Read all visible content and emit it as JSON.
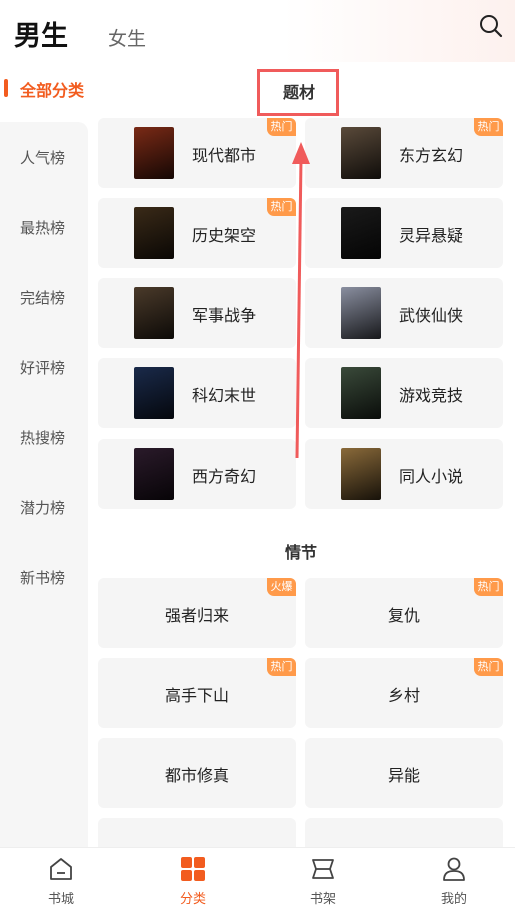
{
  "header": {
    "tab_male": "男生",
    "tab_female": "女生"
  },
  "sidebar": {
    "items": [
      "全部分类",
      "人气榜",
      "最热榜",
      "完结榜",
      "好评榜",
      "热搜榜",
      "潜力榜",
      "新书榜"
    ]
  },
  "sections": {
    "topic_title": "题材",
    "plot_title": "情节"
  },
  "topics": [
    {
      "label": "现代都市",
      "badge": "热门",
      "cover": "#7a2a16"
    },
    {
      "label": "东方玄幻",
      "badge": "热门",
      "cover": "#5a4a3a"
    },
    {
      "label": "历史架空",
      "badge": "热门",
      "cover": "#3a2a18"
    },
    {
      "label": "灵异悬疑",
      "badge": "",
      "cover": "#1a1a1a"
    },
    {
      "label": "军事战争",
      "badge": "",
      "cover": "#4a3a2a"
    },
    {
      "label": "武侠仙侠",
      "badge": "",
      "cover": "#8a8fa0"
    },
    {
      "label": "科幻末世",
      "badge": "",
      "cover": "#1a2a4a"
    },
    {
      "label": "游戏竞技",
      "badge": "",
      "cover": "#3a4a3a"
    },
    {
      "label": "西方奇幻",
      "badge": "",
      "cover": "#2a1a2a"
    },
    {
      "label": "同人小说",
      "badge": "",
      "cover": "#8a6a3a"
    }
  ],
  "plots": [
    {
      "label": "强者归来",
      "badge": "火爆"
    },
    {
      "label": "复仇",
      "badge": "热门"
    },
    {
      "label": "高手下山",
      "badge": "热门"
    },
    {
      "label": "乡村",
      "badge": "热门"
    },
    {
      "label": "都市修真",
      "badge": ""
    },
    {
      "label": "异能",
      "badge": ""
    }
  ],
  "bottom_nav": [
    {
      "label": "书城",
      "icon": "home-icon"
    },
    {
      "label": "分类",
      "icon": "category-icon"
    },
    {
      "label": "书架",
      "icon": "bookshelf-icon"
    },
    {
      "label": "我的",
      "icon": "profile-icon"
    }
  ],
  "colors": {
    "accent": "#f25c1f",
    "badge": "#ff9a4a",
    "annotation": "#f05b5b"
  }
}
